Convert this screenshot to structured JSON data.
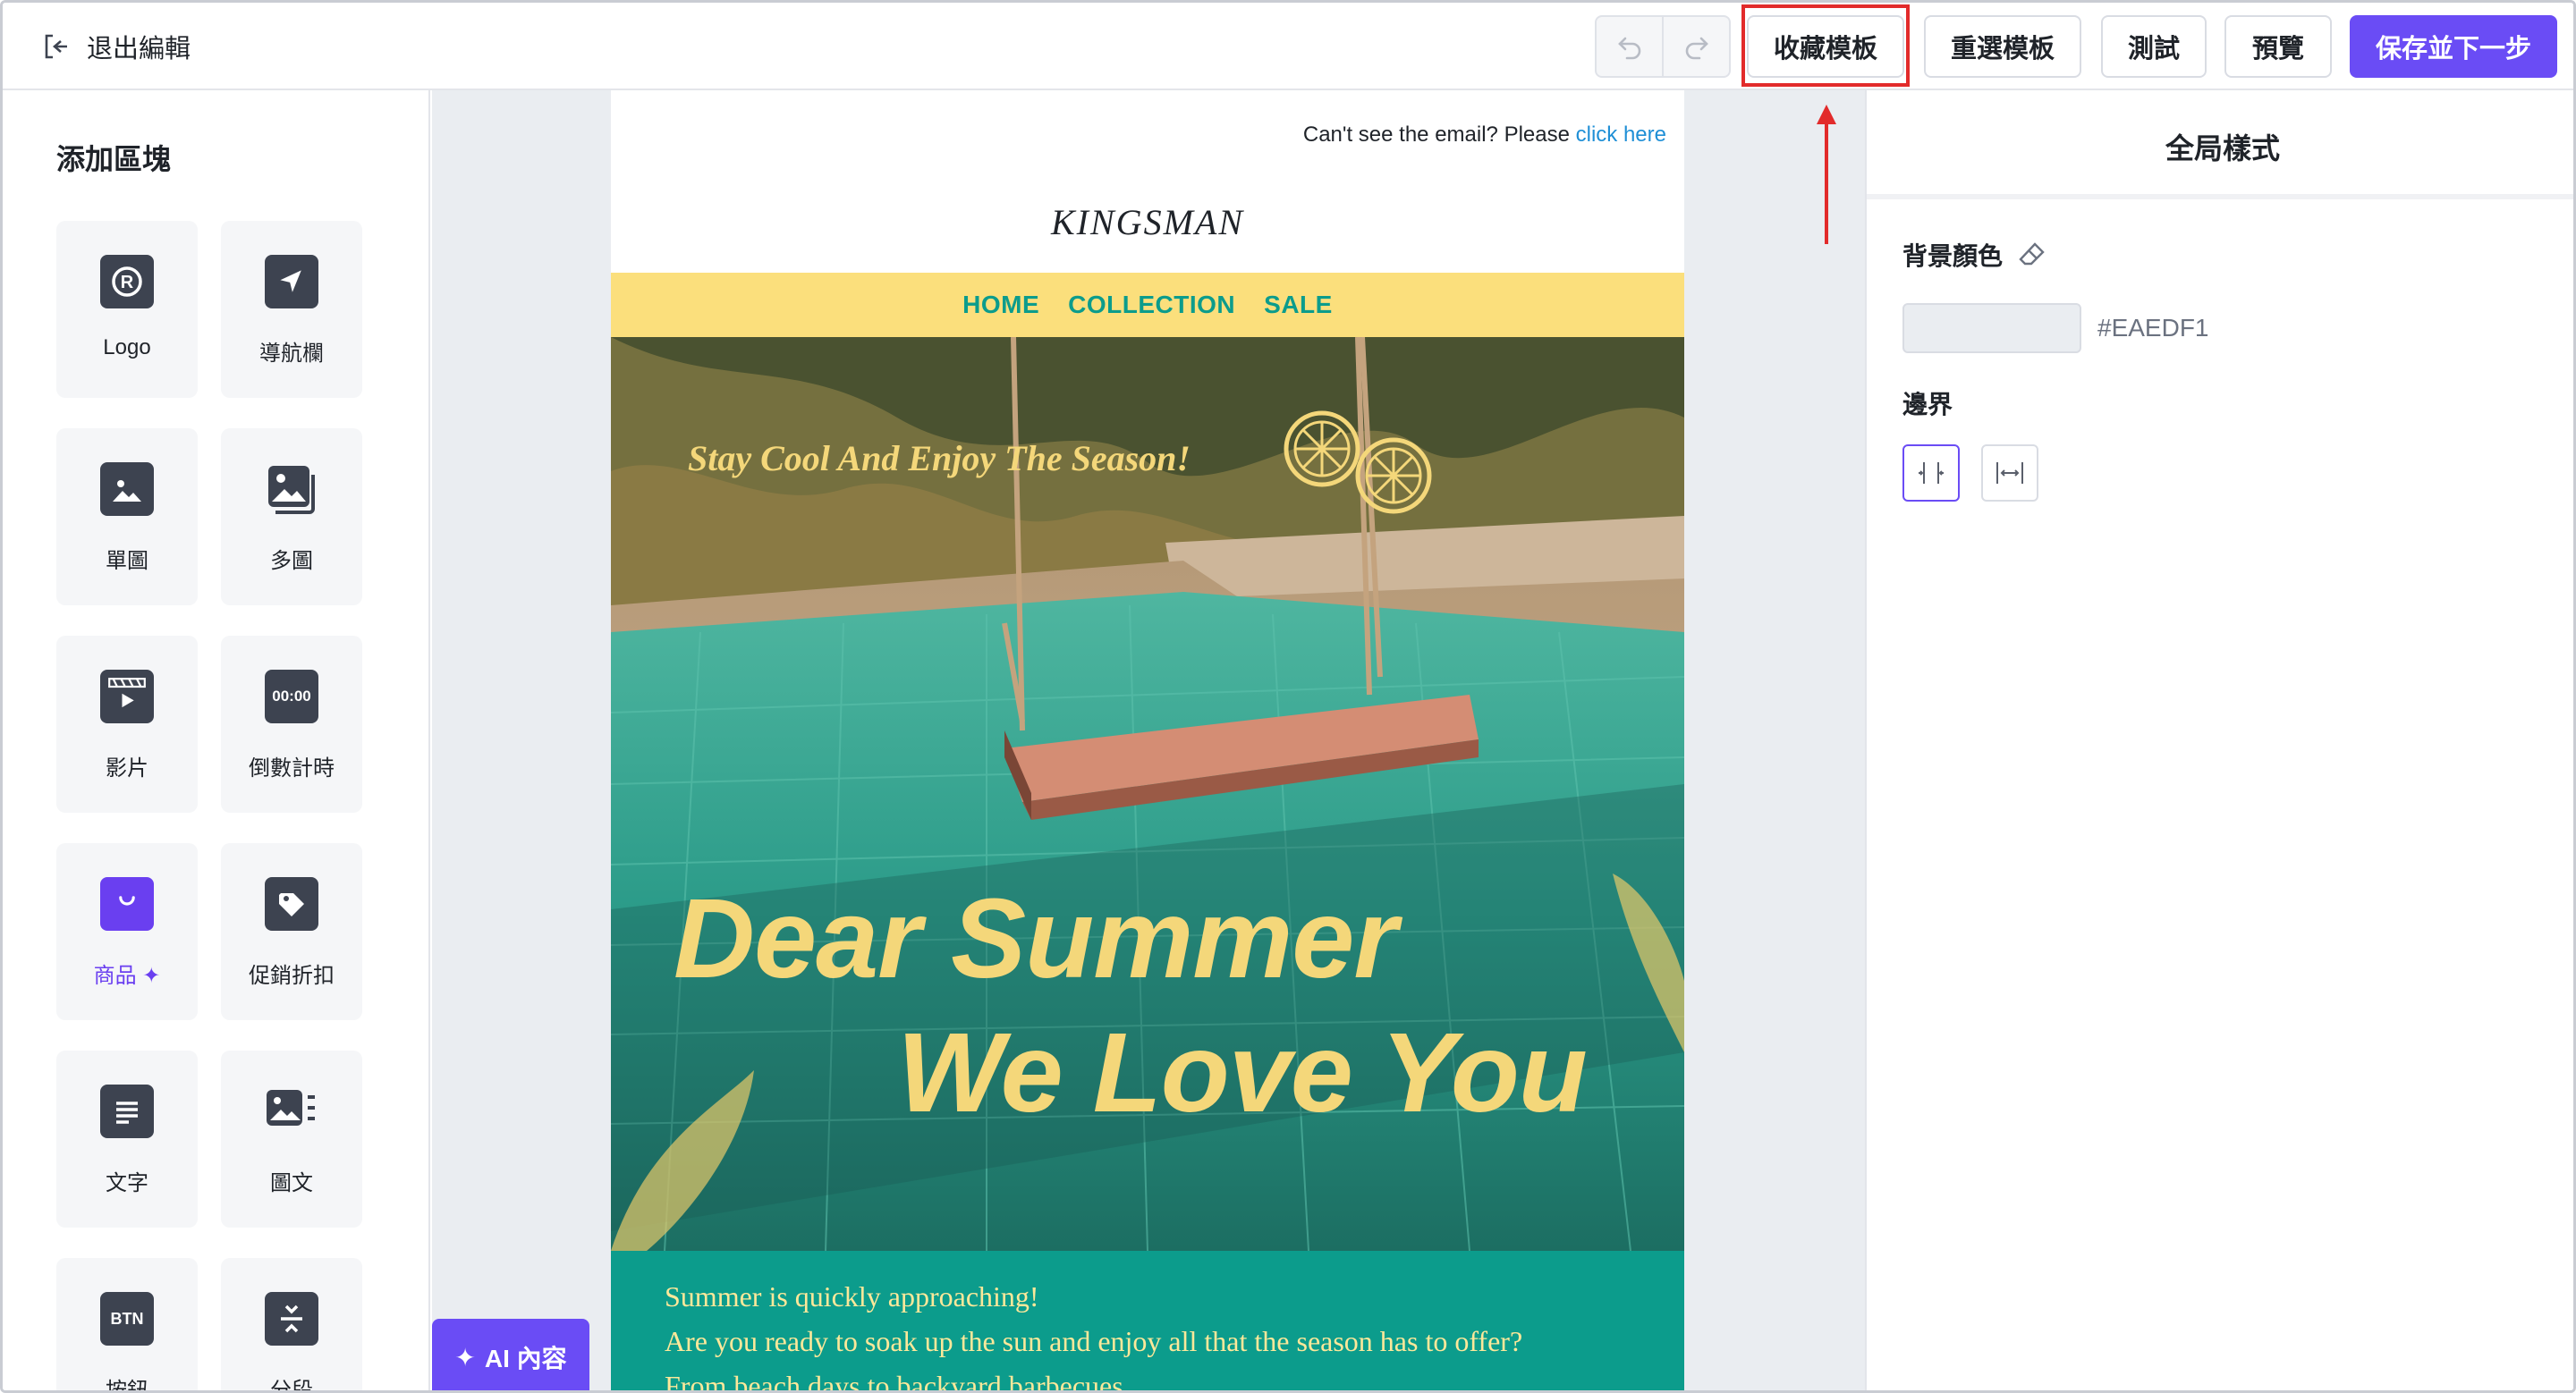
{
  "topbar": {
    "exit_label": "退出編輯",
    "buttons": {
      "favorite": "收藏模板",
      "reselect": "重選模板",
      "test": "測試",
      "preview": "預覽",
      "save_next": "保存並下一步"
    }
  },
  "left_panel": {
    "title": "添加區塊",
    "blocks": [
      {
        "label": "Logo",
        "icon": "logo-icon"
      },
      {
        "label": "導航欄",
        "icon": "navigation-icon"
      },
      {
        "label": "單圖",
        "icon": "image-icon"
      },
      {
        "label": "多圖",
        "icon": "multi-image-icon"
      },
      {
        "label": "影片",
        "icon": "video-icon"
      },
      {
        "label": "倒數計時",
        "icon": "countdown-icon",
        "icon_text": "00:00"
      },
      {
        "label": "商品",
        "icon": "shopping-bag-icon",
        "highlighted": true
      },
      {
        "label": "促銷折扣",
        "icon": "tag-icon"
      },
      {
        "label": "文字",
        "icon": "text-icon"
      },
      {
        "label": "圖文",
        "icon": "image-text-icon"
      },
      {
        "label": "按鈕",
        "icon": "button-icon",
        "icon_text": "BTN"
      },
      {
        "label": "分段",
        "icon": "divider-icon"
      }
    ],
    "accent_color": "#6a3ff0"
  },
  "canvas": {
    "ai_button_label": "AI 內容",
    "background": "#EAEDF1",
    "email": {
      "preheader_text": "Can't see the email? Please ",
      "preheader_link": "click here",
      "brand": "KINGSMAN",
      "nav": [
        "HOME",
        "COLLECTION",
        "SALE"
      ],
      "hero": {
        "tagline": "Stay Cool And Enjoy The Season!",
        "headline_line1": "Dear Summer",
        "headline_line2": "We Love You"
      },
      "body_lines": [
        "Summer is quickly approaching!",
        "Are you ready to soak up the sun and enjoy all that the season has to offer?",
        "From beach days to backyard barbecues,"
      ],
      "colors": {
        "nav_bg": "#fbdf7c",
        "nav_text": "#0c9c8c",
        "text_bg": "#0c9c8c",
        "text_color": "#fce89a"
      }
    }
  },
  "right_panel": {
    "title": "全局樣式",
    "bg_color_label": "背景顏色",
    "bg_color_value": "#EAEDF1",
    "border_label": "邊界"
  },
  "annotation": {
    "highlight_color": "#e22b2b"
  }
}
